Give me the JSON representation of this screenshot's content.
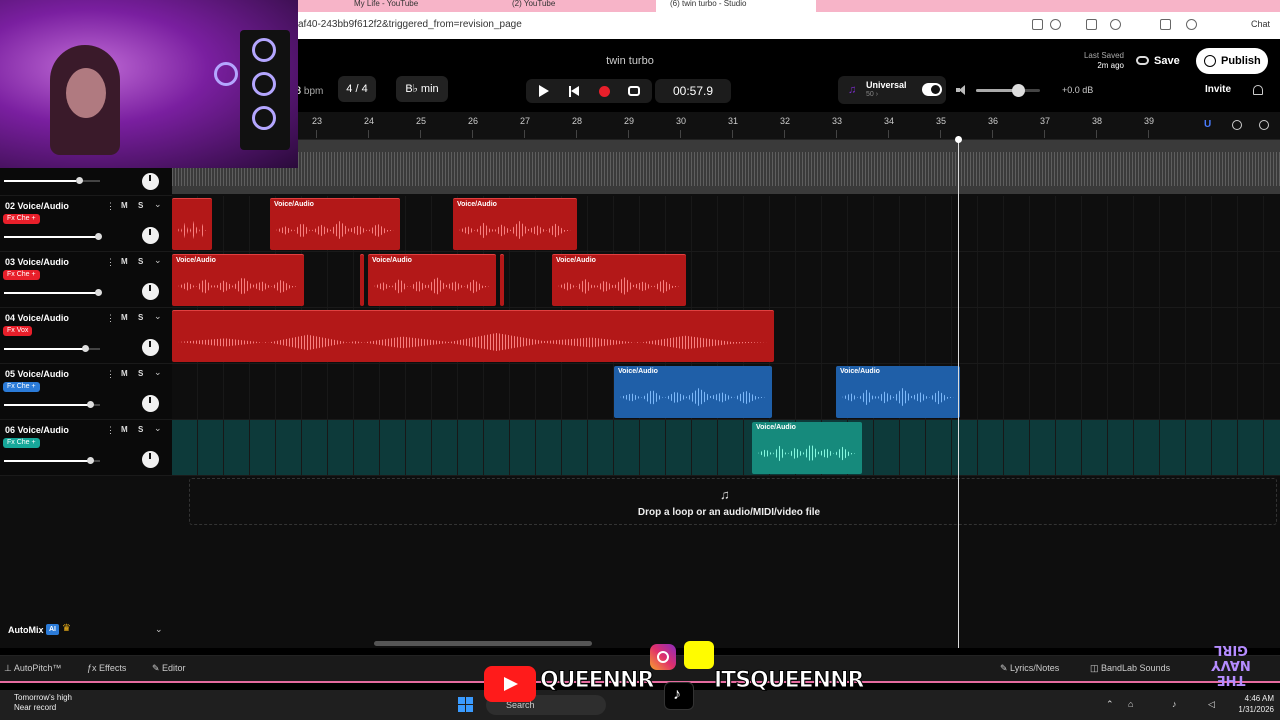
{
  "browser": {
    "tabs": [
      "My Life - YouTube",
      "(2) YouTube",
      "(6) twin turbo - Studio"
    ],
    "url": "af40-243bb9f612f2&triggered_from=revision_page",
    "chat_label": "Chat"
  },
  "header": {
    "song_title": "twin turbo",
    "bpm_value": "3",
    "bpm_unit": "bpm",
    "time_signature": "4 / 4",
    "key": "B♭ min",
    "timecode": "00:57.9",
    "universal_label": "Universal",
    "universal_sub": "50 ›",
    "master_volume_db": "+0.0 dB",
    "master_volume_level": 0.66,
    "last_saved_label": "Last Saved",
    "last_saved_time": "2m ago",
    "save_label": "Save",
    "publish_label": "Publish",
    "invite_label": "Invite"
  },
  "ruler": {
    "bars": [
      "23",
      "24",
      "25",
      "26",
      "27",
      "28",
      "29",
      "30",
      "31",
      "32",
      "33",
      "34",
      "35",
      "36",
      "37",
      "38",
      "39"
    ]
  },
  "tracks": [
    {
      "name": "02 Voice/Audio",
      "fx": "Fx Che +",
      "fx_color": "red",
      "volume": 0.98,
      "mute": "M",
      "solo": "S",
      "clips": [
        {
          "label": "",
          "start": 0,
          "width": 40
        },
        {
          "label": "Voice/Audio",
          "start": 98,
          "width": 130
        },
        {
          "label": "Voice/Audio",
          "start": 281,
          "width": 124
        }
      ]
    },
    {
      "name": "03 Voice/Audio",
      "fx": "Fx Che +",
      "fx_color": "red",
      "volume": 0.98,
      "mute": "M",
      "solo": "S",
      "clips": [
        {
          "label": "Voice/Audio",
          "start": 0,
          "width": 132
        },
        {
          "label": "",
          "start": 188,
          "width": 4
        },
        {
          "label": "Voice/Audio",
          "start": 196,
          "width": 128
        },
        {
          "label": "",
          "start": 328,
          "width": 4
        },
        {
          "label": "Voice/Audio",
          "start": 380,
          "width": 134
        }
      ]
    },
    {
      "name": "04 Voice/Audio",
      "fx": "Fx Vox",
      "fx_color": "red",
      "volume": 0.84,
      "mute": "M",
      "solo": "S",
      "clips": [
        {
          "label": "",
          "start": 0,
          "width": 602
        }
      ]
    },
    {
      "name": "05 Voice/Audio",
      "fx": "Fx Che +",
      "fx_color": "blue",
      "volume": 0.9,
      "mute": "M",
      "solo": "S",
      "clips": [
        {
          "label": "Voice/Audio",
          "start": 442,
          "width": 158
        },
        {
          "label": "Voice/Audio",
          "start": 664,
          "width": 124
        }
      ]
    },
    {
      "name": "06 Voice/Audio",
      "fx": "Fx Che +",
      "fx_color": "teal",
      "volume": 0.9,
      "mute": "M",
      "solo": "S",
      "clips": [
        {
          "label": "Voice/Audio",
          "start": 580,
          "width": 110
        }
      ]
    }
  ],
  "automix": {
    "label": "AutoMix",
    "ai_badge": "AI"
  },
  "dropzone": {
    "text": "Drop a loop or an audio/MIDI/video file"
  },
  "bottombar": {
    "autopitch": "AutoPitch™",
    "effects": "Effects",
    "editor": "Editor",
    "lyrics": "Lyrics/Notes",
    "bandlab_sounds": "BandLab Sounds"
  },
  "taskbar": {
    "weather_title": "Tomorrow's high",
    "weather_sub": "Near record",
    "search": "Search",
    "time": "4:46 AM",
    "date": "1/31/2026"
  },
  "overlay": {
    "handle_left": "QUEENNR",
    "handle_right": "ITSQUEENNR",
    "logo_text": "THE NAVY GIRL"
  },
  "colors": {
    "accent_red": "#e81f2a",
    "accent_blue": "#2b7bd8",
    "accent_teal": "#17a89a",
    "record": "#e81f2a"
  }
}
